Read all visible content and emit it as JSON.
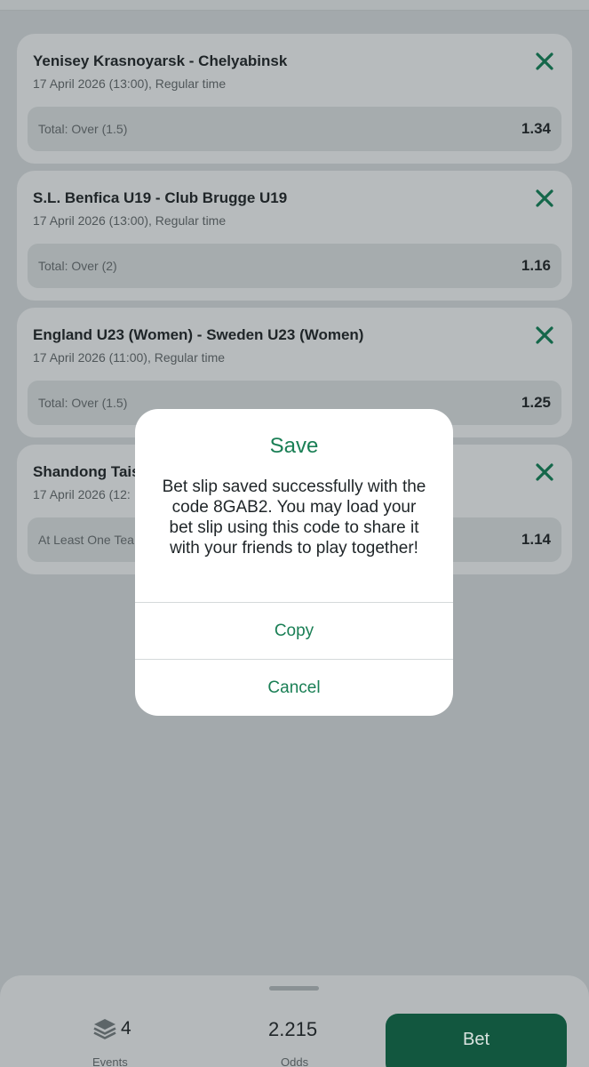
{
  "bets": [
    {
      "match": "Yenisey Krasnoyarsk - Chelyabinsk",
      "datetime": "17 April 2026 (13:00), Regular time",
      "market": "Total: Over (1.5)",
      "odds": "1.34"
    },
    {
      "match": "S.L. Benfica U19 - Club Brugge U19",
      "datetime": "17 April 2026 (13:00), Regular time",
      "market": "Total: Over (2)",
      "odds": "1.16"
    },
    {
      "match": "England U23 (Women) - Sweden U23 (Women)",
      "datetime": "17 April 2026 (11:00), Regular time",
      "market": "Total: Over (1.5)",
      "odds": "1.25"
    },
    {
      "match": "Shandong Tais",
      "datetime": "17 April 2026 (12:",
      "market": "At Least One Tea",
      "odds": "1.14"
    }
  ],
  "bottom_bar": {
    "events_count": "4",
    "events_label": "Events",
    "total_odds": "2.215",
    "odds_label": "Odds",
    "bet_label": "Bet"
  },
  "dialog": {
    "title": "Save",
    "message": "Bet slip saved successfully with the code 8GAB2. You may load your bet slip using this code to share it with your friends to play together!",
    "copy_label": "Copy",
    "cancel_label": "Cancel"
  },
  "colors": {
    "accent": "#1a7f55",
    "bet_button": "#12573f",
    "overlay": "#a3a9ac"
  }
}
